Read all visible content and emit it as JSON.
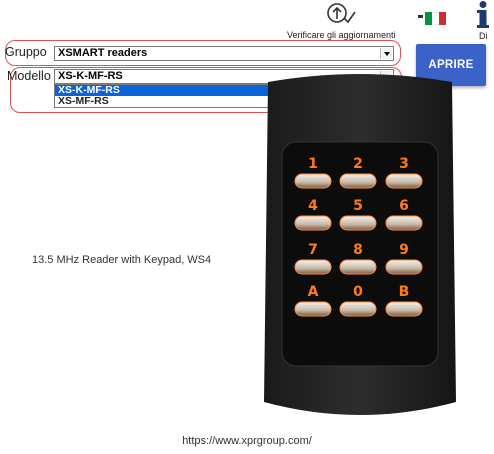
{
  "toolbar": {
    "update_label": "Verificare gli aggiornamenti",
    "info_label": "Di",
    "flag_colors": [
      "#009246",
      "#ffffff",
      "#ce2b37"
    ]
  },
  "form": {
    "group_label": "Gruppo",
    "group_value": "XSMART readers",
    "model_label": "Modello",
    "model_value": "XS-K-MF-RS",
    "model_options": [
      "XS-K-MF-RS",
      "XS-MF-RS"
    ],
    "selected_option": "XS-K-MF-RS"
  },
  "open_button": "APRIRE",
  "product": {
    "description": "13.5 MHz Reader with Keypad, WS4",
    "keys": [
      "1",
      "2",
      "3",
      "4",
      "5",
      "6",
      "7",
      "8",
      "9",
      "A",
      "0",
      "B"
    ]
  },
  "footer_url": "https://www.xprgroup.com/",
  "colors": {
    "accent": "#3a62c9",
    "highlight": "#e05050",
    "selection": "#0a63d8",
    "key_digit": "#ff7a1a"
  }
}
